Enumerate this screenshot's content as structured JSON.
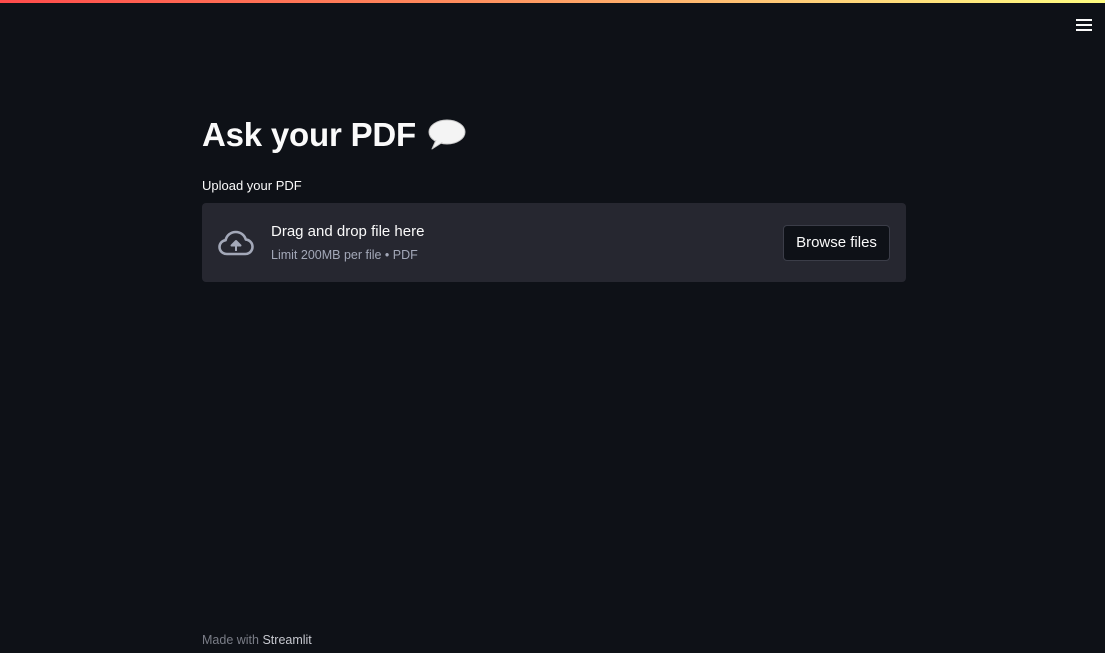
{
  "header": {
    "menu_icon": "hamburger-menu-icon",
    "accent_gradient": [
      "#ff4b4b",
      "#fffd80"
    ]
  },
  "main": {
    "title": "Ask your PDF",
    "title_icon": "speech-bubble-icon",
    "uploader": {
      "label": "Upload your PDF",
      "icon": "cloud-upload-icon",
      "drop_title": "Drag and drop file here",
      "limit_text": "Limit 200MB per file • PDF",
      "browse_label": "Browse files"
    }
  },
  "footer": {
    "prefix": "Made with",
    "link_text": "Streamlit"
  },
  "colors": {
    "background": "#0e1117",
    "dropzone": "#262730",
    "text": "#fafafa",
    "muted": "#a3a8b8"
  }
}
